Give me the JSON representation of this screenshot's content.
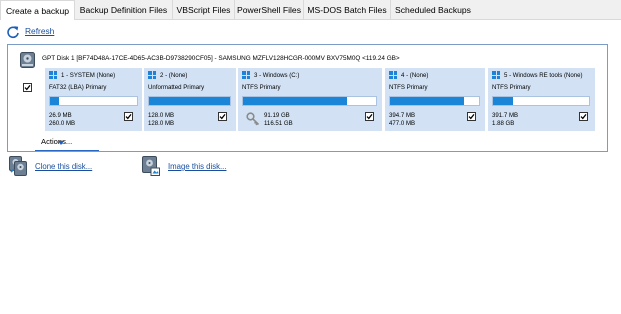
{
  "tabs": [
    {
      "label": "Create a backup",
      "active": true
    },
    {
      "label": "Backup Definition Files",
      "active": false
    },
    {
      "label": "VBScript Files",
      "active": false
    },
    {
      "label": "PowerShell Files",
      "active": false
    },
    {
      "label": "MS-DOS Batch Files",
      "active": false
    },
    {
      "label": "Scheduled Backups",
      "active": false
    }
  ],
  "toolbar": {
    "refresh_label": "Refresh",
    "refresh_icon": "refresh-icon"
  },
  "disk": {
    "title": "GPT Disk 1 [BF74D48A-17CE-4D65-AC3B-D9738290CF05] - SAMSUNG MZFLV128HCGR-000MV BXV75M0Q  <119.24 GB>",
    "selected": true,
    "icon": "hard-disk-icon",
    "partitions": [
      {
        "name": "1 - SYSTEM (None)",
        "type": "FAT32 (LBA) Primary",
        "used": "26.9 MB",
        "total": "260.0 MB",
        "fill": 0.1,
        "checked": true
      },
      {
        "name": "2 - (None)",
        "type": "Unformatted Primary",
        "used": "128.0 MB",
        "total": "128.0 MB",
        "fill": 1.0,
        "checked": true
      },
      {
        "name": "3 - Windows (C:)",
        "type": "NTFS Primary",
        "used": "91.19 GB",
        "total": "116.51 GB",
        "fill": 0.78,
        "checked": true,
        "boot_icon": "boot-key-icon"
      },
      {
        "name": "4 - (None)",
        "type": "NTFS Primary",
        "used": "394.7 MB",
        "total": "477.0 MB",
        "fill": 0.83,
        "checked": true
      },
      {
        "name": "5 - Windows RE tools (None)",
        "type": "NTFS Primary",
        "used": "391.7 MB",
        "total": "1.88 GB",
        "fill": 0.21,
        "checked": true
      }
    ],
    "actions_label": "Actions..."
  },
  "links": {
    "clone_label": "Clone this disk...",
    "image_label": "Image this disk..."
  },
  "colors": {
    "link": "#1a4fa0",
    "partition_bg": "#d2e2f4",
    "bar_fill": "#1b86d8",
    "panel_border": "#7a9cc6"
  }
}
